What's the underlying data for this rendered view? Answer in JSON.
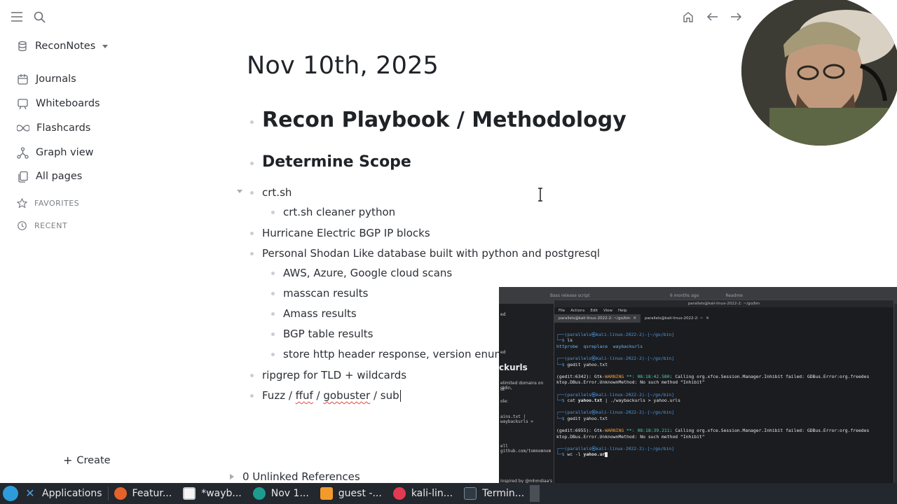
{
  "topbar": {
    "left_icons": [
      "menu-icon",
      "search-icon"
    ],
    "right_icons": [
      "home-icon",
      "back-arrow-icon",
      "forward-arrow-icon"
    ]
  },
  "sidebar": {
    "graph_name": "ReconNotes",
    "items": [
      {
        "label": "Journals",
        "icon": "calendar-icon"
      },
      {
        "label": "Whiteboards",
        "icon": "whiteboard-icon"
      },
      {
        "label": "Flashcards",
        "icon": "infinity-icon"
      },
      {
        "label": "Graph view",
        "icon": "graph-icon"
      },
      {
        "label": "All pages",
        "icon": "pages-icon"
      }
    ],
    "favorites_label": "FAVORITES",
    "recent_label": "RECENT",
    "create_label": "Create",
    "create_glyph": "+"
  },
  "page": {
    "journal_title": "Nov 10th, 2025",
    "blocks": [
      {
        "text": "Recon Playbook / Methodology",
        "level": "h1"
      },
      {
        "text": "Determine Scope",
        "level": "h2"
      },
      {
        "text": "crt.sh",
        "level": "t"
      },
      {
        "text": "crt.sh cleaner python",
        "level": "t"
      },
      {
        "text": "Hurricane Electric BGP IP blocks",
        "level": "t"
      },
      {
        "text": "Personal Shodan Like database built with python and postgresql",
        "level": "t"
      },
      {
        "text": "AWS, Azure, Google cloud scans",
        "level": "t"
      },
      {
        "text": "masscan results",
        "level": "t"
      },
      {
        "text": "Amass results",
        "level": "t"
      },
      {
        "text": "BGP table results",
        "level": "t"
      },
      {
        "text": "store http header response, version enum",
        "level": "t"
      },
      {
        "text": "ripgrep for TLD + wildcards",
        "level": "t"
      }
    ],
    "editing_block": {
      "prefix": "Fuzz / ",
      "ffuf": "ffuf",
      "sep": " / ",
      "gobuster": "gobuster",
      "suffix": " / sub"
    },
    "unlinked_refs": "0 Unlinked References"
  },
  "overlay": {
    "strip_left": "Bass release script",
    "strip_right_time": "6 months ago",
    "strip_right_label": "Readme",
    "left_panel": {
      "ckurls": "ckurls",
      "lines": [
        "ed",
        "ed",
        "elimited domains on stdin,",
        "ut",
        "ole:",
        "ains.txt | waybackurls >",
        "ell github.com/tomnomnom",
        "inspired by @mhmdiaa's w"
      ]
    },
    "terminal": {
      "window_title": "parallels@kali-linux-2022-2: ~/go/bin",
      "menu": [
        "File",
        "Actions",
        "Edit",
        "View",
        "Help"
      ],
      "tabs": [
        "parallels@kali-linux-2022-2: ~/go/bin",
        "parallels@kali-linux-2022-2: ~"
      ],
      "prompt": "(parallels㉿kali-linux-2022-2)-[~/go/bin]",
      "cmd1": "ls",
      "ls_output": "httprobe  qsreplace  waybackurls",
      "cmd2": "gedit yahoo.txt",
      "warn1_prefix": "(gedit:6342): Gtk-",
      "warn_word": "WARNING",
      "warn1_time": " **: 08:18:42.580",
      "warn1_rest": ": Calling org.xfce.Session.Manager.Inhibit failed: GDBus.Error:org.freedes",
      "warn1_line2": "ktop.DBus.Error.UnknownMethod: No such method “Inhibit”",
      "cmd3_a": "cat ",
      "cmd3_b": "yahoo.txt",
      "cmd3_c": " | ./waybackurls > yahoo.urls",
      "cmd4": "gedit yahoo.txt",
      "warn2_prefix": "(gedit:6955): Gtk-",
      "warn2_time": " **: 08:18:39.211",
      "warn2_rest": ": Calling org.xfce.Session.Manager.Inhibit failed: GDBus.Error:org.freedes",
      "warn2_line2": "ktop.DBus.Error.UnknownMethod: No such method “Inhibit”",
      "cmd5_a": "wc -l ",
      "cmd5_b": "yahoo.ur"
    }
  },
  "taskbar": {
    "items": [
      {
        "label": "Applications",
        "icon": "kali-menu-icon",
        "color": "#2e9cd9"
      },
      {
        "label": "Featur...",
        "icon": "firefox-icon",
        "color": "#e5622b"
      },
      {
        "label": "*wayb...",
        "icon": "text-editor-icon",
        "color": "#f5f5f5"
      },
      {
        "label": "Nov 1...",
        "icon": "logseq-icon",
        "color": "#1d9b8f"
      },
      {
        "label": "guest -...",
        "icon": "home-folder-icon",
        "color": "#f39a2b"
      },
      {
        "label": "kali-lin...",
        "icon": "parallels-icon",
        "color": "#e23a52"
      },
      {
        "label": "Termin...",
        "icon": "terminal-icon",
        "color": "#2f3a44"
      }
    ]
  },
  "colors": {
    "accent": "#e0443e",
    "terminal_prompt": "#4c9be8",
    "warning": "#f2a33b"
  }
}
